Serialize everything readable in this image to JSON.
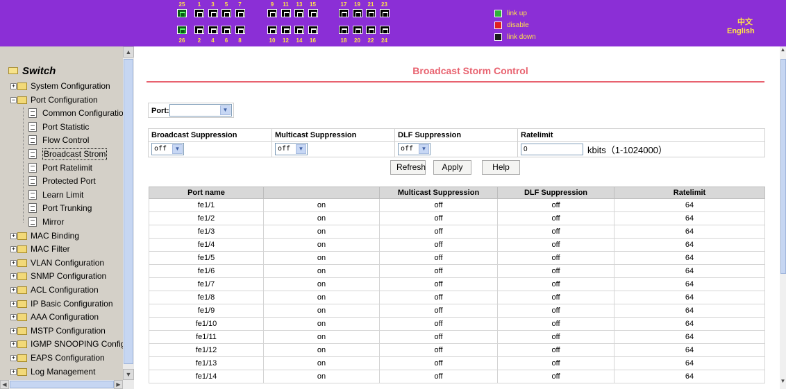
{
  "ports": {
    "top_numbers_fiber": [
      "25"
    ],
    "bottom_numbers_fiber": [
      "26"
    ],
    "top_numbers": [
      "1",
      "3",
      "5",
      "7",
      "9",
      "11",
      "13",
      "15",
      "17",
      "19",
      "21",
      "23"
    ],
    "bottom_numbers": [
      "2",
      "4",
      "6",
      "8",
      "10",
      "12",
      "14",
      "16",
      "18",
      "20",
      "22",
      "24"
    ]
  },
  "legend": [
    {
      "label": "link up",
      "color": "#2fb33a"
    },
    {
      "label": "disable",
      "color": "#e02020"
    },
    {
      "label": "link down",
      "color": "#1a1a1a"
    }
  ],
  "language": {
    "chinese": "中文",
    "english": "English"
  },
  "sidebar": {
    "title": "Switch",
    "items": [
      {
        "label": "System Configuration",
        "type": "folder",
        "level": 0
      },
      {
        "label": "Port Configuration",
        "type": "folder-open",
        "level": 0
      },
      {
        "label": "Common Configuration",
        "type": "doc",
        "level": 1
      },
      {
        "label": "Port Statistic",
        "type": "doc",
        "level": 1
      },
      {
        "label": "Flow Control",
        "type": "doc",
        "level": 1
      },
      {
        "label": "Broadcast Strom",
        "type": "doc",
        "level": 1,
        "selected": true
      },
      {
        "label": "Port Ratelimit",
        "type": "doc",
        "level": 1
      },
      {
        "label": "Protected Port",
        "type": "doc",
        "level": 1
      },
      {
        "label": "Learn Limit",
        "type": "doc",
        "level": 1
      },
      {
        "label": "Port Trunking",
        "type": "doc",
        "level": 1
      },
      {
        "label": "Mirror",
        "type": "doc",
        "level": 1
      },
      {
        "label": "MAC Binding",
        "type": "folder",
        "level": 0
      },
      {
        "label": "MAC Filter",
        "type": "folder",
        "level": 0
      },
      {
        "label": "VLAN Configuration",
        "type": "folder",
        "level": 0
      },
      {
        "label": "SNMP Configuration",
        "type": "folder",
        "level": 0
      },
      {
        "label": "ACL Configuration",
        "type": "folder",
        "level": 0
      },
      {
        "label": "IP Basic Configuration",
        "type": "folder",
        "level": 0
      },
      {
        "label": "AAA Configuration",
        "type": "folder",
        "level": 0
      },
      {
        "label": "MSTP Configuration",
        "type": "folder",
        "level": 0
      },
      {
        "label": "IGMP SNOOPING Config",
        "type": "folder",
        "level": 0
      },
      {
        "label": "EAPS Configuration",
        "type": "folder",
        "level": 0
      },
      {
        "label": "Log Management",
        "type": "folder",
        "level": 0
      }
    ]
  },
  "main": {
    "title": "Broadcast Storm Control",
    "port_label": "Port:",
    "port_value": "",
    "config_headers": [
      "Broadcast Suppression",
      "Multicast Suppression",
      "DLF Suppression",
      "Ratelimit"
    ],
    "broadcast_value": "off",
    "multicast_value": "off",
    "dlf_value": "off",
    "ratelimit_value": "0",
    "ratelimit_unit": "kbits（1-1024000）",
    "buttons": {
      "refresh": "Refresh",
      "apply": "Apply",
      "help": "Help"
    },
    "status_headers": [
      "Port name",
      "",
      "Multicast Suppression",
      "DLF Suppression",
      "Ratelimit"
    ],
    "rows": [
      [
        "fe1/1",
        "on",
        "off",
        "off",
        "64"
      ],
      [
        "fe1/2",
        "on",
        "off",
        "off",
        "64"
      ],
      [
        "fe1/3",
        "on",
        "off",
        "off",
        "64"
      ],
      [
        "fe1/4",
        "on",
        "off",
        "off",
        "64"
      ],
      [
        "fe1/5",
        "on",
        "off",
        "off",
        "64"
      ],
      [
        "fe1/6",
        "on",
        "off",
        "off",
        "64"
      ],
      [
        "fe1/7",
        "on",
        "off",
        "off",
        "64"
      ],
      [
        "fe1/8",
        "on",
        "off",
        "off",
        "64"
      ],
      [
        "fe1/9",
        "on",
        "off",
        "off",
        "64"
      ],
      [
        "fe1/10",
        "on",
        "off",
        "off",
        "64"
      ],
      [
        "fe1/11",
        "on",
        "off",
        "off",
        "64"
      ],
      [
        "fe1/12",
        "on",
        "off",
        "off",
        "64"
      ],
      [
        "fe1/13",
        "on",
        "off",
        "off",
        "64"
      ],
      [
        "fe1/14",
        "on",
        "off",
        "off",
        "64"
      ]
    ]
  }
}
